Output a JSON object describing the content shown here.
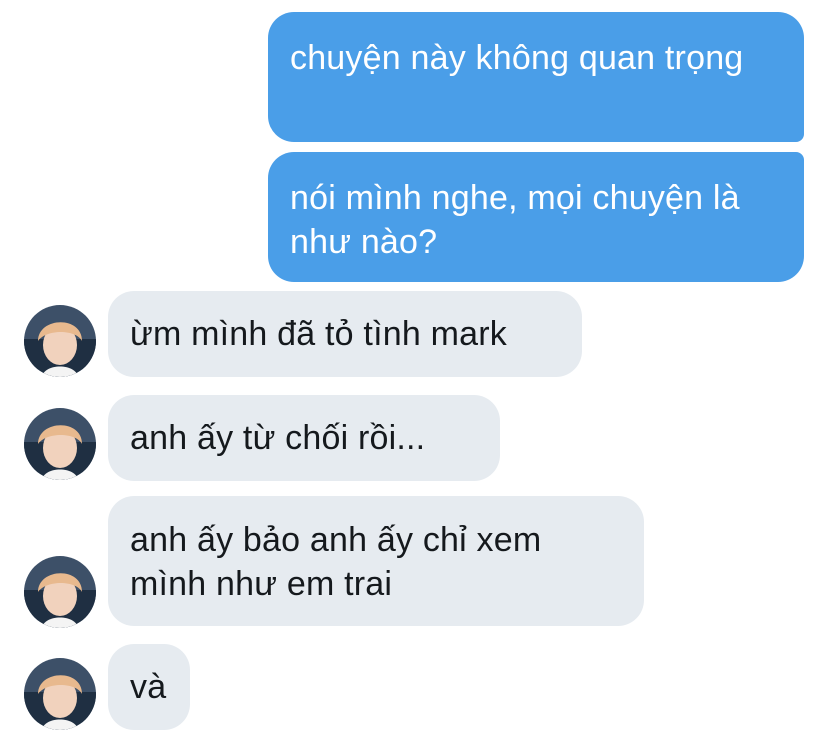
{
  "conversation": {
    "messages": [
      {
        "sender": "me",
        "text": "chuyện này không quan trọng"
      },
      {
        "sender": "me",
        "text": "nói mình nghe, mọi chuyện là như nào?"
      },
      {
        "sender": "other",
        "text": "ừm mình đã tỏ tình mark"
      },
      {
        "sender": "other",
        "text": "anh ấy từ chối rồi..."
      },
      {
        "sender": "other",
        "text": "anh ấy bảo anh ấy chỉ xem mình như em trai"
      },
      {
        "sender": "other",
        "text": "và"
      }
    ]
  },
  "colors": {
    "outgoing_bubble": "#4a9ee8",
    "incoming_bubble": "#e6ebf0",
    "outgoing_text": "#ffffff",
    "incoming_text": "#15191d"
  },
  "icons": {
    "avatar": "contact-avatar-photo"
  }
}
